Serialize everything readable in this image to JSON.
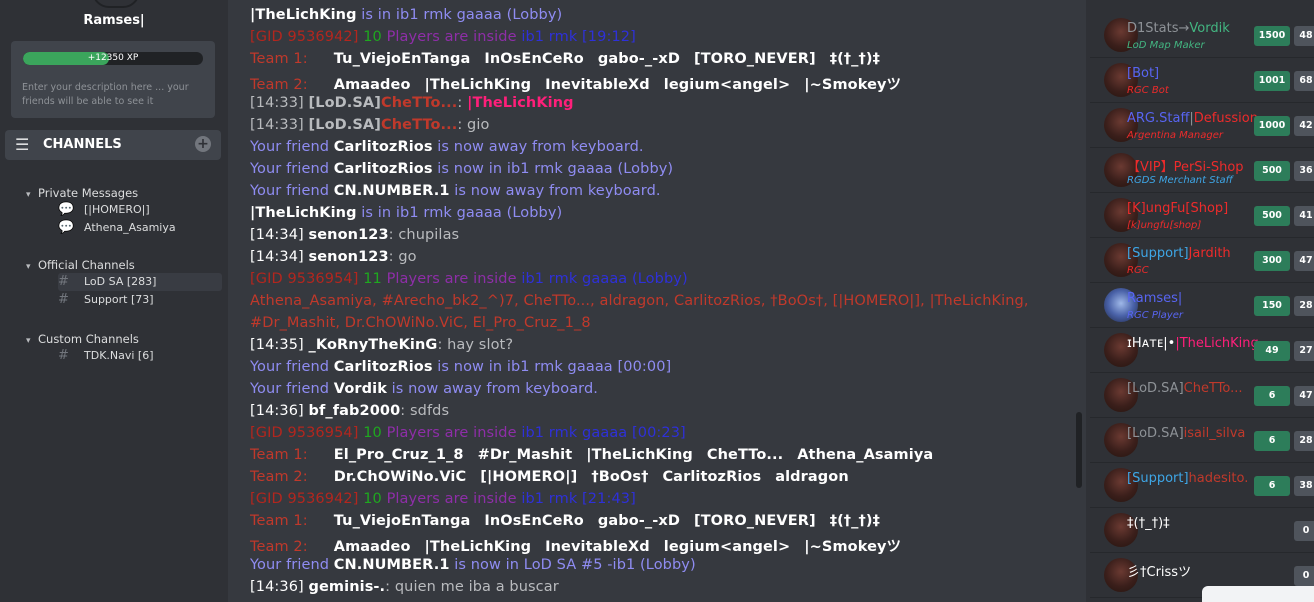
{
  "sidebar": {
    "avatar_badge": "28",
    "username": "Ramses|",
    "xp": {
      "label": "+12350 XP",
      "fill_fraction": 0.48
    },
    "description_placeholder": "Enter your description here ... your friends will be able to see it",
    "channels_header": "CHANNELS",
    "categories": [
      {
        "name": "Private Messages",
        "channels": [
          "[|HOMERO|]",
          "Athena_Asamiya"
        ]
      },
      {
        "name": "Official Channels",
        "channels": [
          "LoD SA [283]",
          "Support [73]"
        ]
      },
      {
        "name": "Custom Channels",
        "channels": [
          "TDK.Navi [6]"
        ]
      }
    ]
  },
  "chat": {
    "lines": [
      {
        "segs": [
          {
            "t": "|TheLichKing",
            "c": "white bold"
          },
          {
            "t": " is in ib1 rmk gaaaa (Lobby)",
            "c": "lilac"
          }
        ]
      },
      {
        "segs": [
          {
            "t": "[GID 9536942]",
            "c": "red"
          },
          {
            "t": " 10 ",
            "c": "green"
          },
          {
            "t": "Players are inside ",
            "c": "purple"
          },
          {
            "t": "ib1 rmk",
            "c": "blue"
          },
          {
            "t": " [19:12]",
            "c": "blue"
          }
        ]
      },
      {
        "team": "Team 1:",
        "players": [
          {
            "t": "Tu_ViejoEnTanga"
          },
          {
            "t": "InOsEnCeRo"
          },
          {
            "t": "gabo-_-xD"
          },
          {
            "t": "[TORO_NEVER]"
          },
          {
            "t": "‡(†_†)‡"
          }
        ]
      },
      {
        "team": "Team 2:",
        "players": [
          {
            "t": "Amaadeo"
          },
          {
            "t": "|TheLichKing",
            "c": "pink"
          },
          {
            "t": "InevitableXd"
          },
          {
            "t": "legium<angel>"
          },
          {
            "t": "|~Smokeyツ"
          }
        ]
      },
      {
        "segs": [
          {
            "t": "[14:33] ",
            "c": "gray"
          },
          {
            "t": "[LoD.SA]",
            "c": "gray bold"
          },
          {
            "t": "CheTTo...",
            "c": "cheto"
          },
          {
            "t": ": ",
            "c": "gray"
          },
          {
            "t": "|TheLichKing",
            "c": "pink"
          }
        ]
      },
      {
        "segs": [
          {
            "t": "[14:33] ",
            "c": "gray"
          },
          {
            "t": "[LoD.SA]",
            "c": "gray bold"
          },
          {
            "t": "CheTTo...",
            "c": "cheto"
          },
          {
            "t": ": gio",
            "c": "gray"
          }
        ]
      },
      {
        "segs": [
          {
            "t": "Your friend ",
            "c": "lilac"
          },
          {
            "t": "CarlitozRios",
            "c": "white bold"
          },
          {
            "t": " is now away from keyboard.",
            "c": "lilac"
          }
        ]
      },
      {
        "segs": [
          {
            "t": "Your friend ",
            "c": "lilac"
          },
          {
            "t": "CarlitozRios",
            "c": "white bold"
          },
          {
            "t": " is now in ib1 rmk gaaaa (Lobby)",
            "c": "lilac"
          }
        ]
      },
      {
        "segs": [
          {
            "t": "Your friend ",
            "c": "lilac"
          },
          {
            "t": "CN.NUMBER.1",
            "c": "white bold"
          },
          {
            "t": " is now away from keyboard.",
            "c": "lilac"
          }
        ]
      },
      {
        "segs": [
          {
            "t": "|TheLichKing",
            "c": "white bold"
          },
          {
            "t": " is in ib1 rmk gaaaa (Lobby)",
            "c": "lilac"
          }
        ]
      },
      {
        "segs": [
          {
            "t": "[14:34] ",
            "c": "white"
          },
          {
            "t": "senon123",
            "c": "white bold"
          },
          {
            "t": ": chupilas",
            "c": "gray"
          }
        ]
      },
      {
        "segs": [
          {
            "t": "[14:34] ",
            "c": "white"
          },
          {
            "t": "senon123",
            "c": "white bold"
          },
          {
            "t": ": go",
            "c": "gray"
          }
        ]
      },
      {
        "segs": [
          {
            "t": "[GID 9536954]",
            "c": "red"
          },
          {
            "t": " 11 ",
            "c": "green"
          },
          {
            "t": "Players are inside ",
            "c": "purple"
          },
          {
            "t": "ib1 rmk gaaaa (Lobby)",
            "c": "blue"
          }
        ]
      },
      {
        "segs": [
          {
            "t": "Athena_Asamiya, #Arecho_bk2_^)7, CheTTo..., aldragon, CarlitozRios, †BoOs†, [|HOMERO|], |TheLichKing,",
            "c": "dred"
          }
        ]
      },
      {
        "segs": [
          {
            "t": "#Dr_Mashit, Dr.ChOWiNo.ViC, El_Pro_Cruz_1_8",
            "c": "dred"
          }
        ]
      },
      {
        "segs": [
          {
            "t": "[14:35] ",
            "c": "white"
          },
          {
            "t": "_KoRnyTheKinG",
            "c": "white bold"
          },
          {
            "t": ": hay slot?",
            "c": "gray"
          }
        ]
      },
      {
        "segs": [
          {
            "t": "Your friend ",
            "c": "lilac"
          },
          {
            "t": "CarlitozRios",
            "c": "white bold"
          },
          {
            "t": " is now in ib1 rmk gaaaa [00:00]",
            "c": "lilac"
          }
        ]
      },
      {
        "segs": [
          {
            "t": "Your friend ",
            "c": "lilac"
          },
          {
            "t": "Vordik",
            "c": "white bold"
          },
          {
            "t": " is now away from keyboard.",
            "c": "lilac"
          }
        ]
      },
      {
        "segs": [
          {
            "t": "[14:36] ",
            "c": "white"
          },
          {
            "t": "bf_fab2000",
            "c": "white bold"
          },
          {
            "t": ": sdfds",
            "c": "gray"
          }
        ]
      },
      {
        "segs": [
          {
            "t": "[GID 9536954]",
            "c": "red"
          },
          {
            "t": " 10 ",
            "c": "green"
          },
          {
            "t": "Players are inside ",
            "c": "purple"
          },
          {
            "t": "ib1 rmk gaaaa",
            "c": "blue"
          },
          {
            "t": " [00:23]",
            "c": "blue"
          }
        ]
      },
      {
        "team": "Team 1:",
        "players": [
          {
            "t": "El_Pro_Cruz_1_8"
          },
          {
            "t": "#Dr_Mashit"
          },
          {
            "t": "|TheLichKing",
            "c": "pink"
          },
          {
            "t": "CheTTo...",
            "c": "cheto"
          },
          {
            "t": "Athena_Asamiya"
          }
        ]
      },
      {
        "team": "Team 2:",
        "players": [
          {
            "t": "Dr.ChOWiNo.ViC"
          },
          {
            "t": "[|HOMERO|]"
          },
          {
            "t": "†BoOs†"
          },
          {
            "t": "CarlitozRios"
          },
          {
            "t": "aldragon"
          }
        ]
      },
      {
        "segs": [
          {
            "t": "[GID 9536942]",
            "c": "red"
          },
          {
            "t": " 10 ",
            "c": "green"
          },
          {
            "t": "Players are inside ",
            "c": "purple"
          },
          {
            "t": "ib1 rmk",
            "c": "blue"
          },
          {
            "t": " [21:43]",
            "c": "blue"
          }
        ]
      },
      {
        "team": "Team 1:",
        "players": [
          {
            "t": "Tu_ViejoEnTanga"
          },
          {
            "t": "InOsEnCeRo"
          },
          {
            "t": "gabo-_-xD"
          },
          {
            "t": "[TORO_NEVER]"
          },
          {
            "t": "‡(†_†)‡"
          }
        ]
      },
      {
        "team": "Team 2:",
        "players": [
          {
            "t": "Amaadeo"
          },
          {
            "t": "|TheLichKing",
            "c": "pink"
          },
          {
            "t": "InevitableXd"
          },
          {
            "t": "legium<angel>"
          },
          {
            "t": "|~Smokeyツ"
          }
        ]
      },
      {
        "segs": [
          {
            "t": "Your friend ",
            "c": "lilac"
          },
          {
            "t": "CN.NUMBER.1",
            "c": "white bold"
          },
          {
            "t": " is now in LoD SA #5 -ib1 (Lobby)",
            "c": "lilac"
          }
        ]
      },
      {
        "segs": [
          {
            "t": "[14:36] ",
            "c": "white"
          },
          {
            "t": "geminis-.",
            "c": "white bold"
          },
          {
            "t": ": quien me iba a buscar",
            "c": "gray"
          }
        ]
      }
    ]
  },
  "users": [
    {
      "name": [
        {
          "t": "D1Stats",
          "c": "#8e9297"
        },
        {
          "t": "→",
          "c": "#8e9297"
        },
        {
          "t": "Vordik",
          "c": "#43b581"
        }
      ],
      "sub": "LoD Map Maker",
      "sub_color": "#43b581",
      "score": "1500",
      "level": "48"
    },
    {
      "name": [
        {
          "t": "[Bot]",
          "c": "#5865f2"
        }
      ],
      "sub": "RGC Bot",
      "sub_color": "#ed2b2b",
      "score": "1001",
      "level": "68"
    },
    {
      "name": [
        {
          "t": "ARG.Staff",
          "c": "#5865f2"
        },
        {
          "t": "|",
          "c": "#8e9297"
        },
        {
          "t": "Defussion",
          "c": "#ed2b2b"
        }
      ],
      "sub": "Argentina Manager",
      "sub_color": "#ed2b2b",
      "score": "1000",
      "level": "42"
    },
    {
      "name": [
        {
          "t": "【VIP】PerSi-Shop",
          "c": "#ed2b2b"
        }
      ],
      "sub": "RGDS Merchant Staff",
      "sub_color": "#3ea6e6",
      "score": "500",
      "level": "36"
    },
    {
      "name": [
        {
          "t": "[K]ungFu[Shop]",
          "c": "#ed2b2b"
        }
      ],
      "sub": "[k]ungfu[shop]",
      "sub_color": "#ed2b2b",
      "score": "500",
      "level": "41"
    },
    {
      "name": [
        {
          "t": "[Support]",
          "c": "#3ea6e6"
        },
        {
          "t": "Jardith",
          "c": "#ed2b2b"
        }
      ],
      "sub": "RGC",
      "sub_color": "#ed2b2b",
      "score": "300",
      "level": "47"
    },
    {
      "name": [
        {
          "t": "Ramses|",
          "c": "#5865f2"
        }
      ],
      "sub": "RGC Player",
      "sub_color": "#5865f2",
      "score": "150",
      "level": "28",
      "blue": true
    },
    {
      "name": [
        {
          "t": "ɪHᴀᴛᴇ|•",
          "c": "#ffffff"
        },
        {
          "t": "|TheLichKing",
          "c": "#ff1f7a"
        }
      ],
      "sub": "",
      "sub_color": "",
      "score": "49",
      "level": "27"
    },
    {
      "name": [
        {
          "t": "[LoD.SA]",
          "c": "#8e9297"
        },
        {
          "t": "CheTTo...",
          "c": "#c0392b"
        }
      ],
      "sub": "",
      "sub_color": "",
      "score": "6",
      "level": "47"
    },
    {
      "name": [
        {
          "t": "[LoD.SA]",
          "c": "#8e9297"
        },
        {
          "t": "isail_silva",
          "c": "#c0392b"
        }
      ],
      "sub": "",
      "sub_color": "",
      "score": "6",
      "level": "28"
    },
    {
      "name": [
        {
          "t": "[Support]",
          "c": "#3ea6e6"
        },
        {
          "t": "hadesito.",
          "c": "#c0392b"
        }
      ],
      "sub": "",
      "sub_color": "",
      "score": "6",
      "level": "38"
    },
    {
      "name": [
        {
          "t": "‡(†_†)‡",
          "c": "#ffffff"
        }
      ],
      "sub": "",
      "sub_color": "",
      "score": "",
      "level": "0"
    },
    {
      "name": [
        {
          "t": "彡†Crissツ",
          "c": "#ffffff"
        }
      ],
      "sub": "",
      "sub_color": "",
      "score": "",
      "level": "0"
    }
  ]
}
